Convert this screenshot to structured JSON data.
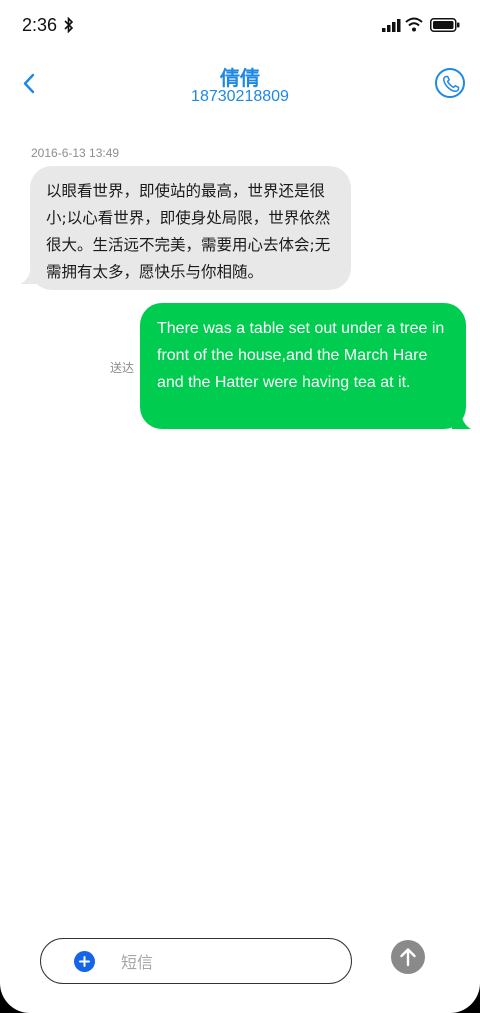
{
  "status_bar": {
    "time": "2:36",
    "icons": [
      "bluetooth-icon",
      "signal-icon",
      "wifi-icon",
      "battery-icon"
    ]
  },
  "header": {
    "contact_name": "倩倩",
    "contact_number": "18730218809",
    "icons": [
      "chevron-left-icon",
      "phone-icon"
    ]
  },
  "messages": {
    "timestamp": "2016-6-13 13:49",
    "incoming": "以眼看世界，即使站的最高，世界还是很小;以心看世界，即使身处局限，世界依然很大。生活远不完美，需要用心去体会;无需拥有太多，愿快乐与你相随。",
    "outgoing": "There was a table set out under a tree in front of the house,and the March Hare and the Hatter were having tea at it.",
    "delivery_status": "送达"
  },
  "composer": {
    "placeholder": "短信",
    "value": "",
    "icons": [
      "plus-icon",
      "arrow-up-icon"
    ]
  },
  "colors": {
    "accent": "#1e88e5",
    "incoming_bubble": "#e8e8e8",
    "outgoing_bubble": "#00cc4f",
    "send_button": "#8a8a8a"
  }
}
